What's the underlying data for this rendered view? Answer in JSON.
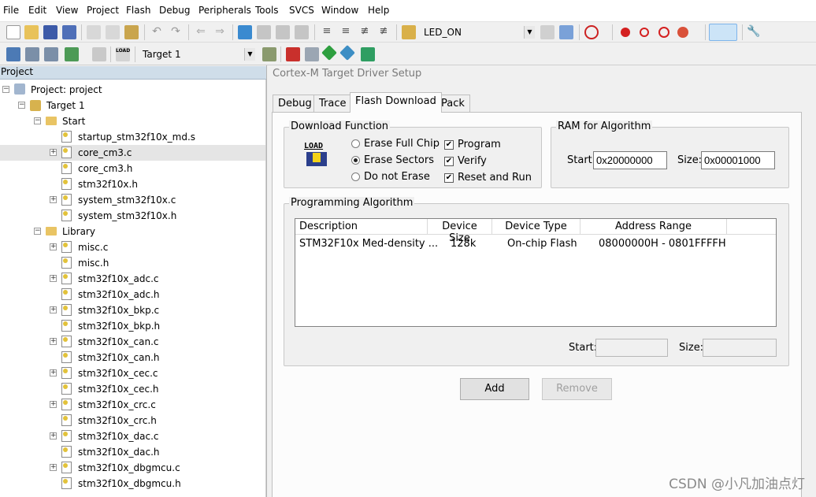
{
  "menubar": {
    "items": [
      "File",
      "Edit",
      "View",
      "Project",
      "Flash",
      "Debug",
      "Peripherals",
      "Tools",
      "SVCS",
      "Window",
      "Help"
    ]
  },
  "toolbar1": {
    "target_combo_value": "LED_ON"
  },
  "toolbar2": {
    "build_target_value": "Target 1"
  },
  "project_panel": {
    "header": "Project",
    "root": "Project: project",
    "target": "Target 1",
    "groups": [
      {
        "name": "Start",
        "files": [
          "startup_stm32f10x_md.s",
          "core_cm3.c",
          "core_cm3.h",
          "stm32f10x.h",
          "system_stm32f10x.c",
          "system_stm32f10x.h"
        ]
      },
      {
        "name": "Library",
        "files": [
          "misc.c",
          "misc.h",
          "stm32f10x_adc.c",
          "stm32f10x_adc.h",
          "stm32f10x_bkp.c",
          "stm32f10x_bkp.h",
          "stm32f10x_can.c",
          "stm32f10x_can.h",
          "stm32f10x_cec.c",
          "stm32f10x_cec.h",
          "stm32f10x_crc.c",
          "stm32f10x_crc.h",
          "stm32f10x_dac.c",
          "stm32f10x_dac.h",
          "stm32f10x_dbgmcu.c",
          "stm32f10x_dbgmcu.h"
        ]
      }
    ]
  },
  "dialog": {
    "title": "Cortex-M Target Driver Setup",
    "tabs": [
      "Debug",
      "Trace",
      "Flash Download",
      "Pack"
    ],
    "active_tab": "Flash Download",
    "download_function": {
      "title": "Download Function",
      "load_icon_text": "LOAD",
      "options": [
        "Erase Full Chip",
        "Erase Sectors",
        "Do not Erase"
      ],
      "selected_option": "Erase Sectors",
      "checks": [
        {
          "label": "Program",
          "checked": true
        },
        {
          "label": "Verify",
          "checked": true
        },
        {
          "label": "Reset and Run",
          "checked": true
        }
      ]
    },
    "ram": {
      "title": "RAM for Algorithm",
      "start_label": "Start:",
      "start_value": "0x20000000",
      "size_label": "Size:",
      "size_value": "0x00001000"
    },
    "programming_algorithm": {
      "title": "Programming Algorithm",
      "columns": [
        "Description",
        "Device Size",
        "Device Type",
        "Address Range"
      ],
      "rows": [
        [
          "STM32F10x Med-density ...",
          "128k",
          "On-chip Flash",
          "08000000H - 0801FFFFH"
        ]
      ],
      "start_label": "Start:",
      "start_value": "",
      "size_label": "Size:",
      "size_value": ""
    },
    "buttons": {
      "add": "Add",
      "remove": "Remove"
    }
  },
  "watermark": "CSDN @小凡加油点灯",
  "colors": {
    "accent": "#cfdde9",
    "check_mark": "✔"
  }
}
